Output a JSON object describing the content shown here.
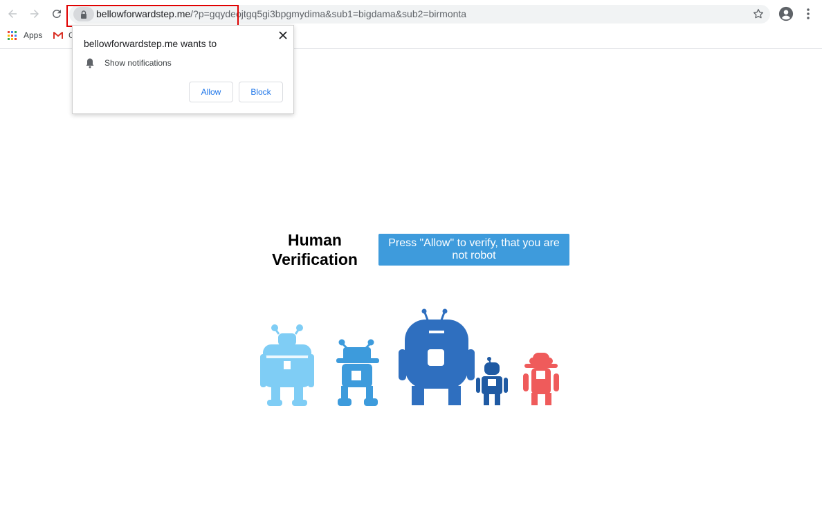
{
  "browser": {
    "url_host": "bellowforwardstep.me",
    "url_rest": "/?p=gqydeojtgq5gi3bpgmydima&sub1=bigdama&sub2=birmonta",
    "bookmarks": [
      {
        "label": "Apps",
        "icon": "apps-grid-icon"
      },
      {
        "label": "G",
        "icon": "gmail-icon"
      }
    ],
    "highlight_color": "#e00000"
  },
  "popup": {
    "title": "bellowforwardstep.me wants to",
    "permission": "Show notifications",
    "allow_label": "Allow",
    "block_label": "Block",
    "accent": "#1a73e8"
  },
  "page": {
    "heading": "Human Verification",
    "button_label": "Press \"Allow\" to verify, that you are not robot",
    "button_color": "#3e9bdc",
    "robot_colors": [
      "#7fcdf5",
      "#3d9bdc",
      "#2f6fbf",
      "#1f5aa3",
      "#ef5b5b"
    ]
  }
}
